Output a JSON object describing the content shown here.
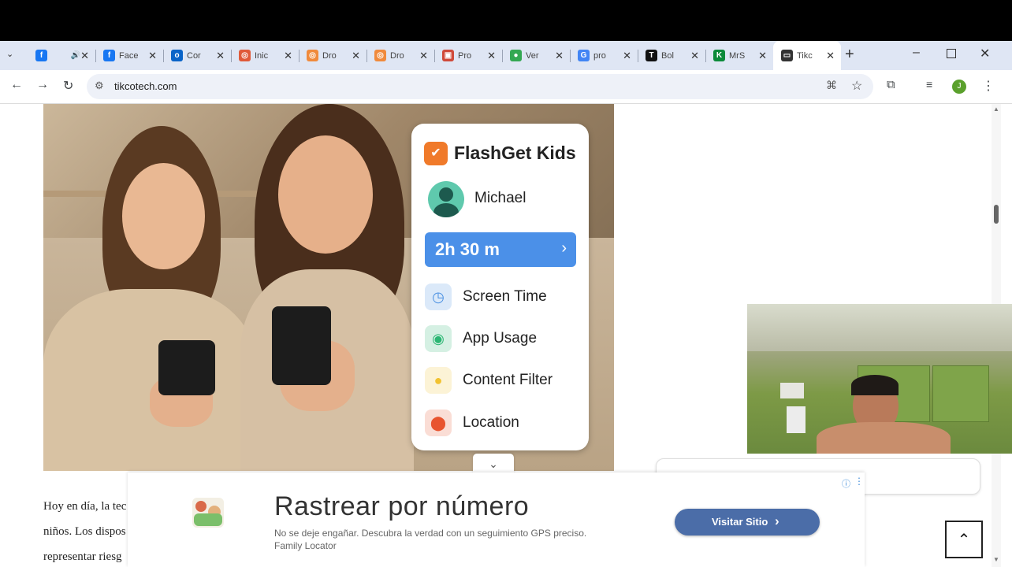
{
  "browser": {
    "tabs": [
      {
        "title": "",
        "icon": "facebook-icon",
        "color": "#1877f2",
        "glyph": "f",
        "audio": true
      },
      {
        "title": "Face",
        "icon": "facebook-icon",
        "color": "#1877f2",
        "glyph": "f"
      },
      {
        "title": "Cor",
        "icon": "outlook-icon",
        "color": "#0a64c8",
        "glyph": "o"
      },
      {
        "title": "Inic",
        "icon": "site-icon",
        "color": "#e05a3a",
        "glyph": "◎"
      },
      {
        "title": "Dro",
        "icon": "site-icon",
        "color": "#f08a3c",
        "glyph": "◎"
      },
      {
        "title": "Dro",
        "icon": "site-icon",
        "color": "#f08a3c",
        "glyph": "◎"
      },
      {
        "title": "Pro",
        "icon": "site-icon",
        "color": "#d04a3a",
        "glyph": "▣"
      },
      {
        "title": "Ver",
        "icon": "maps-icon",
        "color": "#34a853",
        "glyph": "●"
      },
      {
        "title": "pro",
        "icon": "google-icon",
        "color": "#4285f4",
        "glyph": "G"
      },
      {
        "title": "Bol",
        "icon": "site-icon",
        "color": "#111111",
        "glyph": "T"
      },
      {
        "title": "MrS",
        "icon": "site-icon",
        "color": "#0c8a3a",
        "glyph": "K"
      },
      {
        "title": "Tikc",
        "icon": "laptop-icon",
        "color": "#333333",
        "glyph": "▭",
        "active": true
      }
    ],
    "url": "tikcotech.com",
    "profile_initial": "J"
  },
  "app_card": {
    "brand": "FlashGet Kids",
    "child_name": "Michael",
    "time": "2h 30 m",
    "rows": [
      {
        "label": "Screen Time",
        "icon": "clock-icon",
        "color": "#4a90e2"
      },
      {
        "label": "App Usage",
        "icon": "gauge-icon",
        "color": "#2bb673"
      },
      {
        "label": "Content Filter",
        "icon": "bulb-icon",
        "color": "#f2c230"
      },
      {
        "label": "Location",
        "icon": "pin-icon",
        "color": "#e8542f"
      }
    ]
  },
  "article": {
    "line1": "Hoy en día, la tec",
    "line2": "niños. Los dispos",
    "line3": "representar riesg"
  },
  "ad": {
    "headline": "Rastrear por número",
    "body": "No se deje engañar. Descubra la verdad con un seguimiento GPS preciso.",
    "advertiser": "Family Locator",
    "cta": "Visitar Sitio"
  }
}
